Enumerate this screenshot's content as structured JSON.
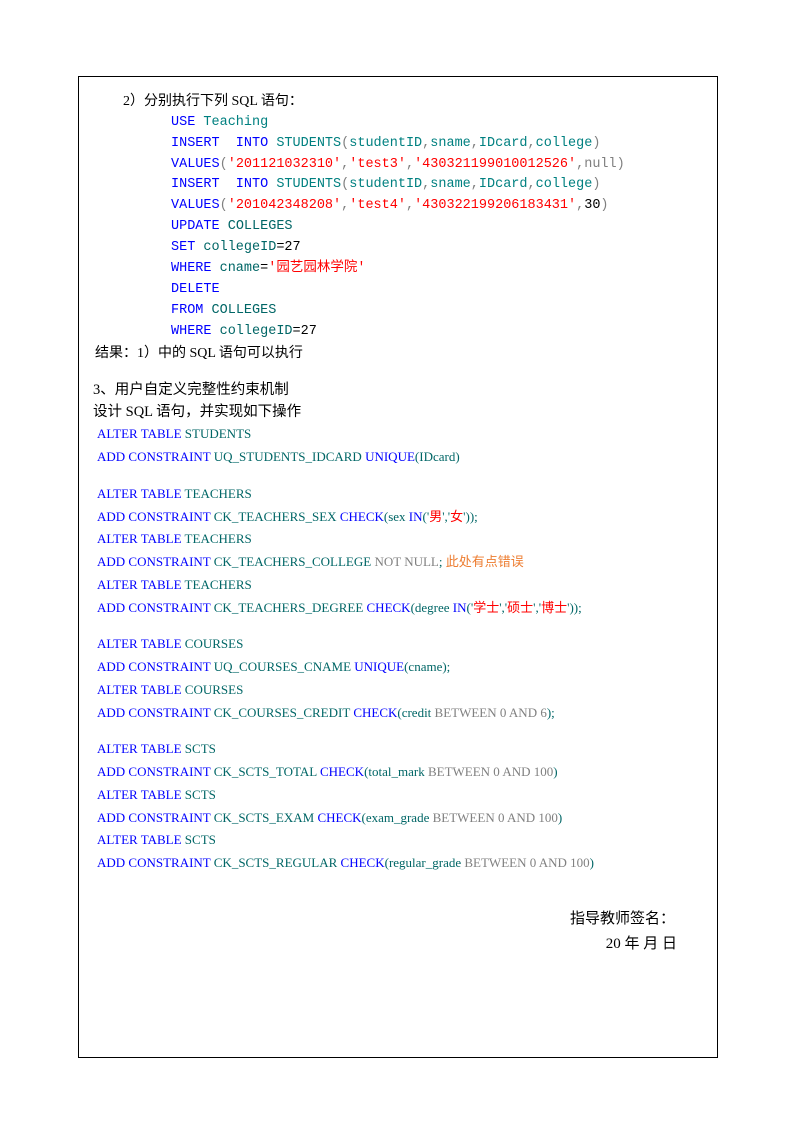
{
  "section2": {
    "title": "2）分别执行下列 SQL 语句：",
    "code": [
      {
        "segments": [
          {
            "t": "USE ",
            "c": "blue"
          },
          {
            "t": "Teaching",
            "c": "teal"
          }
        ]
      },
      {
        "segments": [
          {
            "t": "INSERT  INTO ",
            "c": "blue"
          },
          {
            "t": "STUDENTS",
            "c": "teal"
          },
          {
            "t": "(",
            "c": "gray"
          },
          {
            "t": "studentID",
            "c": "teal"
          },
          {
            "t": ",",
            "c": "gray"
          },
          {
            "t": "sname",
            "c": "teal"
          },
          {
            "t": ",",
            "c": "gray"
          },
          {
            "t": "IDcard",
            "c": "teal"
          },
          {
            "t": ",",
            "c": "gray"
          },
          {
            "t": "college",
            "c": "teal"
          },
          {
            "t": ")",
            "c": "gray"
          }
        ]
      },
      {
        "segments": [
          {
            "t": "VALUES",
            "c": "blue"
          },
          {
            "t": "(",
            "c": "gray"
          },
          {
            "t": "'201121032310'",
            "c": "red"
          },
          {
            "t": ",",
            "c": "gray"
          },
          {
            "t": "'test3'",
            "c": "red"
          },
          {
            "t": ",",
            "c": "gray"
          },
          {
            "t": "'430321199010012526'",
            "c": "red"
          },
          {
            "t": ",",
            "c": "gray"
          },
          {
            "t": "null",
            "c": "gray"
          },
          {
            "t": ")",
            "c": "gray"
          }
        ]
      },
      {
        "segments": [
          {
            "t": "INSERT  INTO ",
            "c": "blue"
          },
          {
            "t": "STUDENTS",
            "c": "teal"
          },
          {
            "t": "(",
            "c": "gray"
          },
          {
            "t": "studentID",
            "c": "teal"
          },
          {
            "t": ",",
            "c": "gray"
          },
          {
            "t": "sname",
            "c": "teal"
          },
          {
            "t": ",",
            "c": "gray"
          },
          {
            "t": "IDcard",
            "c": "teal"
          },
          {
            "t": ",",
            "c": "gray"
          },
          {
            "t": "college",
            "c": "teal"
          },
          {
            "t": ")",
            "c": "gray"
          }
        ]
      },
      {
        "segments": [
          {
            "t": "VALUES",
            "c": "blue"
          },
          {
            "t": "(",
            "c": "gray"
          },
          {
            "t": "'201042348208'",
            "c": "red"
          },
          {
            "t": ",",
            "c": "gray"
          },
          {
            "t": "'test4'",
            "c": "red"
          },
          {
            "t": ",",
            "c": "gray"
          },
          {
            "t": "'430322199206183431'",
            "c": "red"
          },
          {
            "t": ",",
            "c": "gray"
          },
          {
            "t": "30",
            "c": "black"
          },
          {
            "t": ")",
            "c": "gray"
          }
        ]
      },
      {
        "segments": [
          {
            "t": "UPDATE ",
            "c": "blue"
          },
          {
            "t": "COLLEGES",
            "c": "green"
          }
        ]
      },
      {
        "segments": [
          {
            "t": "SET ",
            "c": "blue"
          },
          {
            "t": "collegeID",
            "c": "green"
          },
          {
            "t": "=27",
            "c": "black"
          }
        ]
      },
      {
        "segments": [
          {
            "t": "WHERE ",
            "c": "blue"
          },
          {
            "t": "cname",
            "c": "green"
          },
          {
            "t": "=",
            "c": "black"
          },
          {
            "t": "'园艺园林学院'",
            "c": "red"
          }
        ]
      },
      {
        "segments": [
          {
            "t": "DELETE",
            "c": "blue"
          }
        ]
      },
      {
        "segments": [
          {
            "t": "FROM ",
            "c": "blue"
          },
          {
            "t": "COLLEGES",
            "c": "green"
          }
        ]
      },
      {
        "segments": [
          {
            "t": "WHERE ",
            "c": "blue"
          },
          {
            "t": "collegeID",
            "c": "green"
          },
          {
            "t": "=27",
            "c": "black"
          }
        ]
      }
    ],
    "result": "结果：1）中的 SQL 语句可以执行"
  },
  "section3": {
    "heading": "3、用户自定义完整性约束机制",
    "subheading": "设计 SQL 语句，并实现如下操作",
    "blocks": [
      [
        {
          "segments": [
            {
              "t": "ALTER TABLE",
              "c": "blue"
            },
            {
              "t": " STUDENTS",
              "c": "green"
            }
          ]
        },
        {
          "segments": [
            {
              "t": "ADD CONSTRAINT",
              "c": "blue"
            },
            {
              "t": " UQ_STUDENTS_IDCARD ",
              "c": "green"
            },
            {
              "t": " UNIQUE",
              "c": "blue"
            },
            {
              "t": "(IDcard)",
              "c": "green"
            }
          ]
        }
      ],
      [
        {
          "segments": [
            {
              "t": "ALTER TABLE",
              "c": "blue"
            },
            {
              "t": " TEACHERS",
              "c": "green"
            }
          ]
        },
        {
          "segments": [
            {
              "t": "ADD CONSTRAINT",
              "c": "blue"
            },
            {
              "t": " CK_TEACHERS_SEX",
              "c": "green"
            },
            {
              "t": " CHECK",
              "c": "blue"
            },
            {
              "t": "(sex ",
              "c": "green"
            },
            {
              "t": "IN",
              "c": "blue"
            },
            {
              "t": "('",
              "c": "green"
            },
            {
              "t": "男",
              "c": "red"
            },
            {
              "t": "','",
              "c": "green"
            },
            {
              "t": "女",
              "c": "red"
            },
            {
              "t": "'));",
              "c": "green"
            }
          ]
        },
        {
          "segments": [
            {
              "t": "ALTER TABLE",
              "c": "blue"
            },
            {
              "t": " TEACHERS",
              "c": "green"
            }
          ]
        },
        {
          "segments": [
            {
              "t": "ADD CONSTRAINT",
              "c": "blue"
            },
            {
              "t": " CK_TEACHERS_COLLEGE ",
              "c": "green"
            },
            {
              "t": " NOT NULL",
              "c": "gray"
            },
            {
              "t": ";    ",
              "c": "green"
            },
            {
              "t": "此处有点错误",
              "c": "orange"
            }
          ]
        },
        {
          "segments": [
            {
              "t": "ALTER TABLE",
              "c": "blue"
            },
            {
              "t": " TEACHERS",
              "c": "green"
            }
          ]
        },
        {
          "segments": [
            {
              "t": "ADD CONSTRAINT",
              "c": "blue"
            },
            {
              "t": " CK_TEACHERS_DEGREE ",
              "c": "green"
            },
            {
              "t": " CHECK",
              "c": "blue"
            },
            {
              "t": "(degree ",
              "c": "green"
            },
            {
              "t": "IN",
              "c": "blue"
            },
            {
              "t": "('",
              "c": "green"
            },
            {
              "t": "学士",
              "c": "red"
            },
            {
              "t": "','",
              "c": "green"
            },
            {
              "t": "硕士",
              "c": "red"
            },
            {
              "t": "','",
              "c": "green"
            },
            {
              "t": "博士",
              "c": "red"
            },
            {
              "t": "'));",
              "c": "green"
            }
          ]
        }
      ],
      [
        {
          "segments": [
            {
              "t": "ALTER TABLE",
              "c": "blue"
            },
            {
              "t": " COURSES",
              "c": "green"
            }
          ]
        },
        {
          "segments": [
            {
              "t": "ADD CONSTRAINT",
              "c": "blue"
            },
            {
              "t": " UQ_COURSES_CNAME ",
              "c": "green"
            },
            {
              "t": " UNIQUE",
              "c": "blue"
            },
            {
              "t": "(cname);",
              "c": "green"
            }
          ]
        },
        {
          "segments": [
            {
              "t": "ALTER TABLE",
              "c": "blue"
            },
            {
              "t": " COURSES",
              "c": "green"
            }
          ]
        },
        {
          "segments": [
            {
              "t": "ADD CONSTRAINT",
              "c": "blue"
            },
            {
              "t": " CK_COURSES_CREDIT",
              "c": "green"
            },
            {
              "t": " CHECK",
              "c": "blue"
            },
            {
              "t": "(credit ",
              "c": "green"
            },
            {
              "t": "BETWEEN 0 AND 6",
              "c": "gray"
            },
            {
              "t": ");",
              "c": "green"
            }
          ]
        }
      ],
      [
        {
          "segments": [
            {
              "t": "ALTER TABLE",
              "c": "blue"
            },
            {
              "t": " SCTS",
              "c": "green"
            }
          ]
        },
        {
          "segments": [
            {
              "t": "ADD CONSTRAINT",
              "c": "blue"
            },
            {
              "t": " CK_SCTS_TOTAL",
              "c": "green"
            },
            {
              "t": " CHECK",
              "c": "blue"
            },
            {
              "t": "(total_mark ",
              "c": "green"
            },
            {
              "t": "BETWEEN 0 AND 100",
              "c": "gray"
            },
            {
              "t": ")",
              "c": "green"
            }
          ]
        },
        {
          "segments": [
            {
              "t": "ALTER TABLE",
              "c": "blue"
            },
            {
              "t": " SCTS",
              "c": "green"
            }
          ]
        },
        {
          "segments": [
            {
              "t": "ADD CONSTRAINT",
              "c": "blue"
            },
            {
              "t": " CK_SCTS_EXAM",
              "c": "green"
            },
            {
              "t": " CHECK",
              "c": "blue"
            },
            {
              "t": "(exam_grade ",
              "c": "green"
            },
            {
              "t": "BETWEEN 0 AND 100",
              "c": "gray"
            },
            {
              "t": ")",
              "c": "green"
            }
          ]
        },
        {
          "segments": [
            {
              "t": "ALTER TABLE",
              "c": "blue"
            },
            {
              "t": " SCTS",
              "c": "green"
            }
          ]
        },
        {
          "segments": [
            {
              "t": "ADD CONSTRAINT",
              "c": "blue"
            },
            {
              "t": " CK_SCTS_REGULAR",
              "c": "green"
            },
            {
              "t": " CHECK",
              "c": "blue"
            },
            {
              "t": "(regular_grade ",
              "c": "green"
            },
            {
              "t": "BETWEEN 0 AND 100",
              "c": "gray"
            },
            {
              "t": ")",
              "c": "green"
            }
          ]
        }
      ]
    ]
  },
  "signature": {
    "label": "指导教师签名：",
    "date": "20      年    月    日"
  }
}
